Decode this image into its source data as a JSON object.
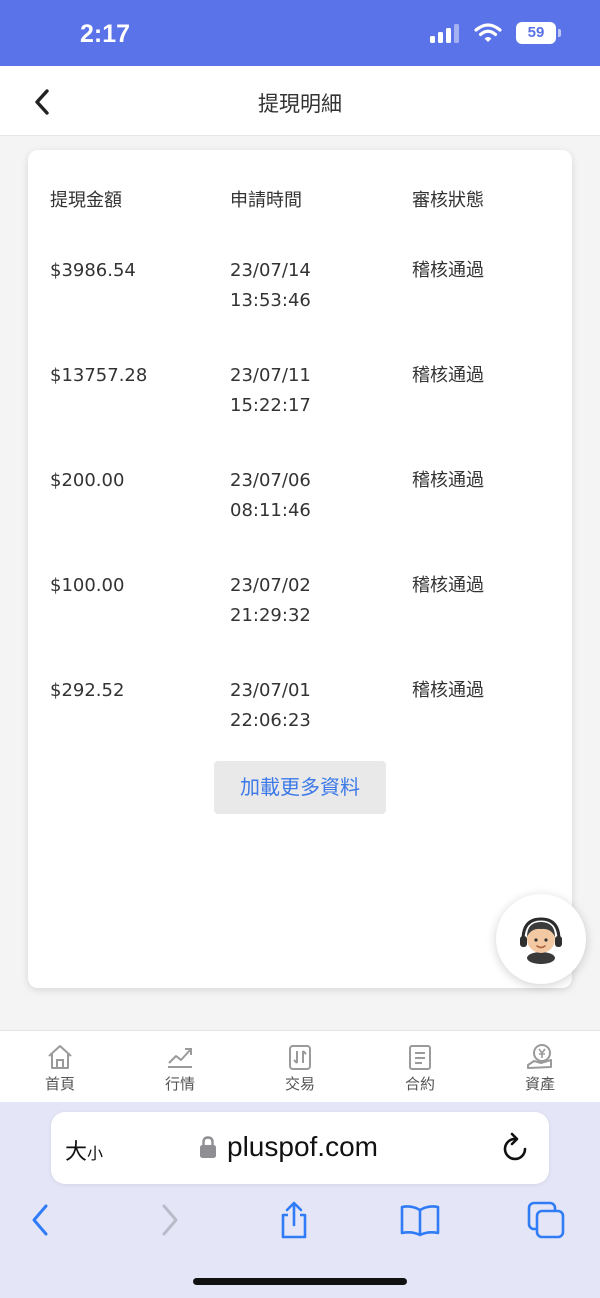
{
  "status_bar": {
    "time": "2:17",
    "battery": "59"
  },
  "header": {
    "title": "提現明細"
  },
  "table": {
    "headers": [
      "提現金額",
      "申請時間",
      "審核狀態"
    ],
    "rows": [
      {
        "amount": "$3986.54",
        "time": "23/07/14 13:53:46",
        "status": "稽核通過"
      },
      {
        "amount": "$13757.28",
        "time": "23/07/11 15:22:17",
        "status": "稽核通過"
      },
      {
        "amount": "$200.00",
        "time": "23/07/06 08:11:46",
        "status": "稽核通過"
      },
      {
        "amount": "$100.00",
        "time": "23/07/02 21:29:32",
        "status": "稽核通過"
      },
      {
        "amount": "$292.52",
        "time": "23/07/01 22:06:23",
        "status": "稽核通過"
      }
    ],
    "load_more": "加載更多資料"
  },
  "tabs": [
    {
      "label": "首頁",
      "icon": "home-icon"
    },
    {
      "label": "行情",
      "icon": "chart-icon"
    },
    {
      "label": "交易",
      "icon": "trade-icon"
    },
    {
      "label": "合約",
      "icon": "contract-icon"
    },
    {
      "label": "資產",
      "icon": "assets-icon"
    }
  ],
  "browser": {
    "aa_large": "大",
    "aa_small": "小",
    "url": "pluspof.com"
  },
  "colors": {
    "status_bar": "#5b73e8",
    "accent": "#3d7ae8",
    "safari_bg": "#e4e6f7",
    "tab_icon": "#9a9a9a"
  }
}
